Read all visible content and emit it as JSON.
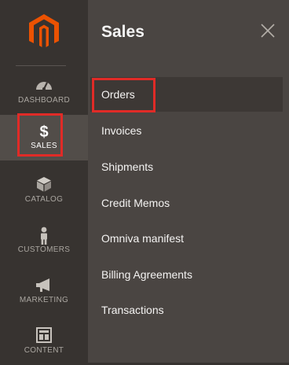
{
  "left_nav": {
    "items": [
      {
        "label": "DASHBOARD",
        "icon": "dashboard-icon"
      },
      {
        "label": "SALES",
        "icon": "dollar-icon"
      },
      {
        "label": "CATALOG",
        "icon": "cube-icon"
      },
      {
        "label": "CUSTOMERS",
        "icon": "person-icon"
      },
      {
        "label": "MARKETING",
        "icon": "megaphone-icon"
      },
      {
        "label": "CONTENT",
        "icon": "layout-icon"
      }
    ]
  },
  "flyout": {
    "title": "Sales",
    "items": [
      {
        "label": "Orders"
      },
      {
        "label": "Invoices"
      },
      {
        "label": "Shipments"
      },
      {
        "label": "Credit Memos"
      },
      {
        "label": "Omniva manifest"
      },
      {
        "label": "Billing Agreements"
      },
      {
        "label": "Transactions"
      }
    ]
  },
  "colors": {
    "nav_bg": "#373330",
    "flyout_bg": "#4a4542",
    "brand_orange": "#eb5202",
    "highlight_red": "#e02b27"
  }
}
